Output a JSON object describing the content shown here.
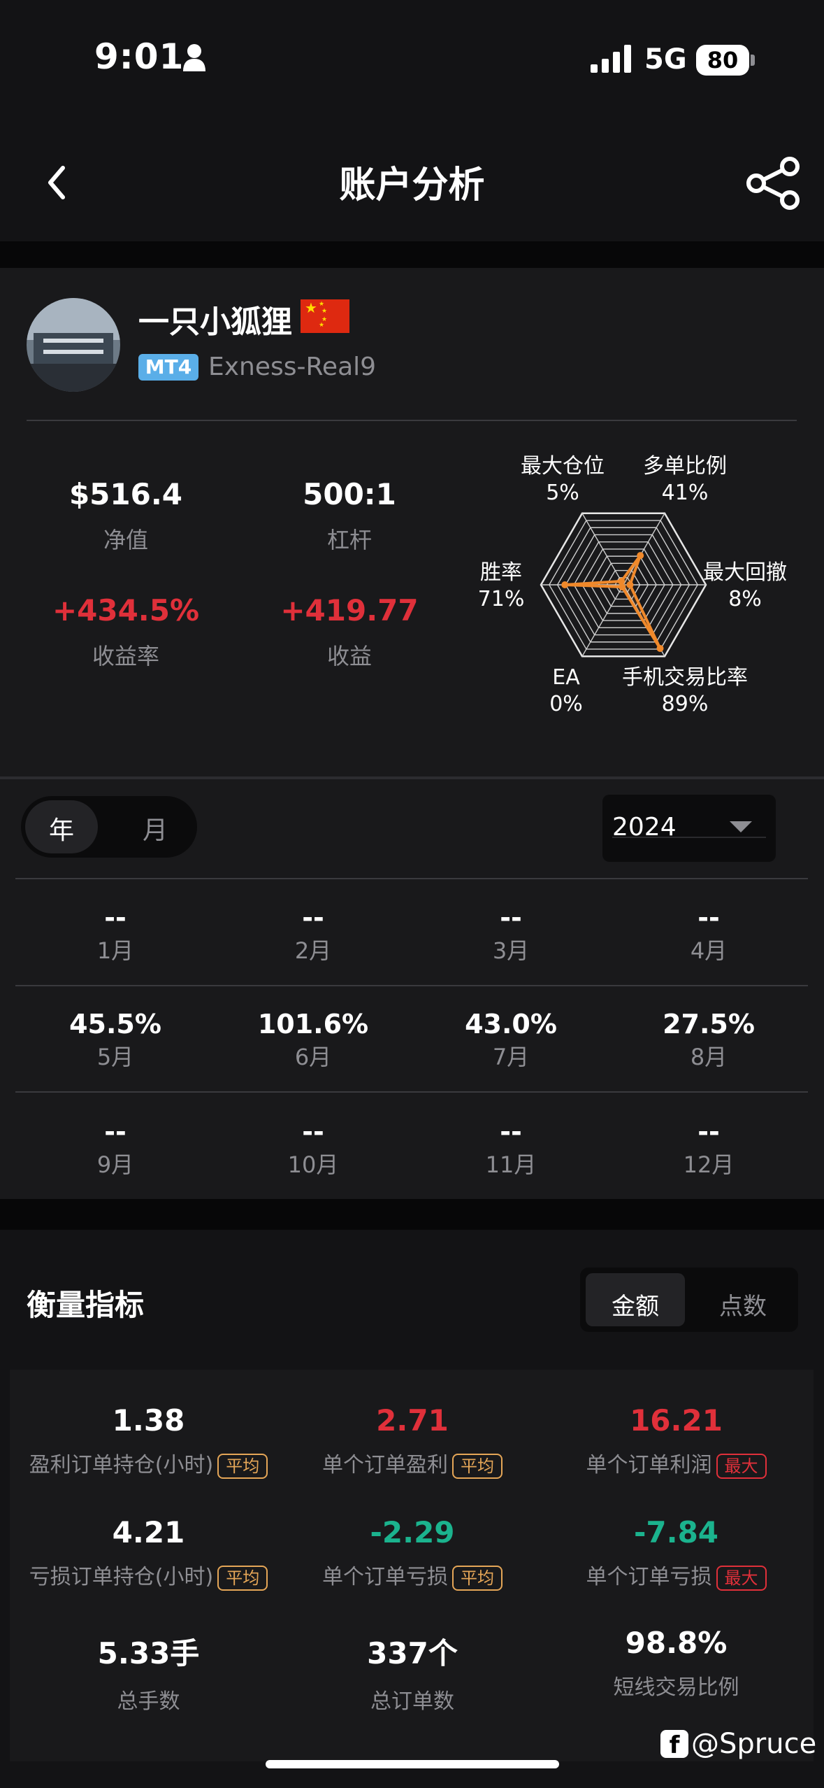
{
  "status": {
    "time": "9:01",
    "network": "5G",
    "battery": "80"
  },
  "header": {
    "title": "账户分析",
    "back_icon": "chevron-left-icon",
    "share_icon": "share-icon"
  },
  "profile": {
    "name": "一只小狐狸",
    "flag": "🇨🇳",
    "platform_badge": "MT4",
    "server": "Exness-Real9"
  },
  "stats": [
    {
      "value": "$516.4",
      "label": "净值"
    },
    {
      "value": "500:1",
      "label": "杠杆"
    },
    {
      "value": "+434.5%",
      "label": "收益率"
    },
    {
      "value": "+419.77",
      "label": "收益"
    }
  ],
  "radar": {
    "axes": [
      {
        "name": "最大仓位",
        "value": "5%",
        "fraction": 0.05
      },
      {
        "name": "多单比例",
        "value": "41%",
        "fraction": 0.41
      },
      {
        "name": "最大回撤",
        "value": "8%",
        "fraction": 0.08
      },
      {
        "name": "手机交易比率",
        "value": "89%",
        "fraction": 0.89
      },
      {
        "name": "EA",
        "value": "0%",
        "fraction": 0.0
      },
      {
        "name": "胜率",
        "value": "71%",
        "fraction": 0.71
      }
    ],
    "series_color": "#f0892b"
  },
  "period_toggle": {
    "year": "年",
    "month": "月",
    "selected": "年"
  },
  "year_select": {
    "value": "2024"
  },
  "months": [
    {
      "value": "--",
      "label": "1月"
    },
    {
      "value": "--",
      "label": "2月"
    },
    {
      "value": "--",
      "label": "3月"
    },
    {
      "value": "--",
      "label": "4月"
    },
    {
      "value": "45.5%",
      "label": "5月"
    },
    {
      "value": "101.6%",
      "label": "6月"
    },
    {
      "value": "43.0%",
      "label": "7月"
    },
    {
      "value": "27.5%",
      "label": "8月"
    },
    {
      "value": "--",
      "label": "9月"
    },
    {
      "value": "--",
      "label": "10月"
    },
    {
      "value": "--",
      "label": "11月"
    },
    {
      "value": "--",
      "label": "12月"
    }
  ],
  "metrics": {
    "title": "衡量指标",
    "toggle": {
      "amount": "金额",
      "points": "点数",
      "selected": "金额"
    },
    "items": [
      {
        "value": "1.38",
        "label": "盈利订单持仓(小时)",
        "tag": "平均"
      },
      {
        "value": "2.71",
        "label": "单个订单盈利",
        "tag": "平均"
      },
      {
        "value": "16.21",
        "label": "单个订单利润",
        "tag": "最大"
      },
      {
        "value": "4.21",
        "label": "亏损订单持仓(小时)",
        "tag": "平均"
      },
      {
        "value": "-2.29",
        "label": "单个订单亏损",
        "tag": "平均"
      },
      {
        "value": "-7.84",
        "label": "单个订单亏损",
        "tag": "最大"
      },
      {
        "value": "5.33手",
        "label": "总手数"
      },
      {
        "value": "337个",
        "label": "总订单数"
      },
      {
        "value": "98.8%",
        "label": "短线交易比例"
      }
    ]
  },
  "watermark": "@Spruce",
  "colors": {
    "positive": "#e0303a",
    "negative": "#1bb38e",
    "accent": "#f0892b",
    "badge": "#5aaee8"
  }
}
